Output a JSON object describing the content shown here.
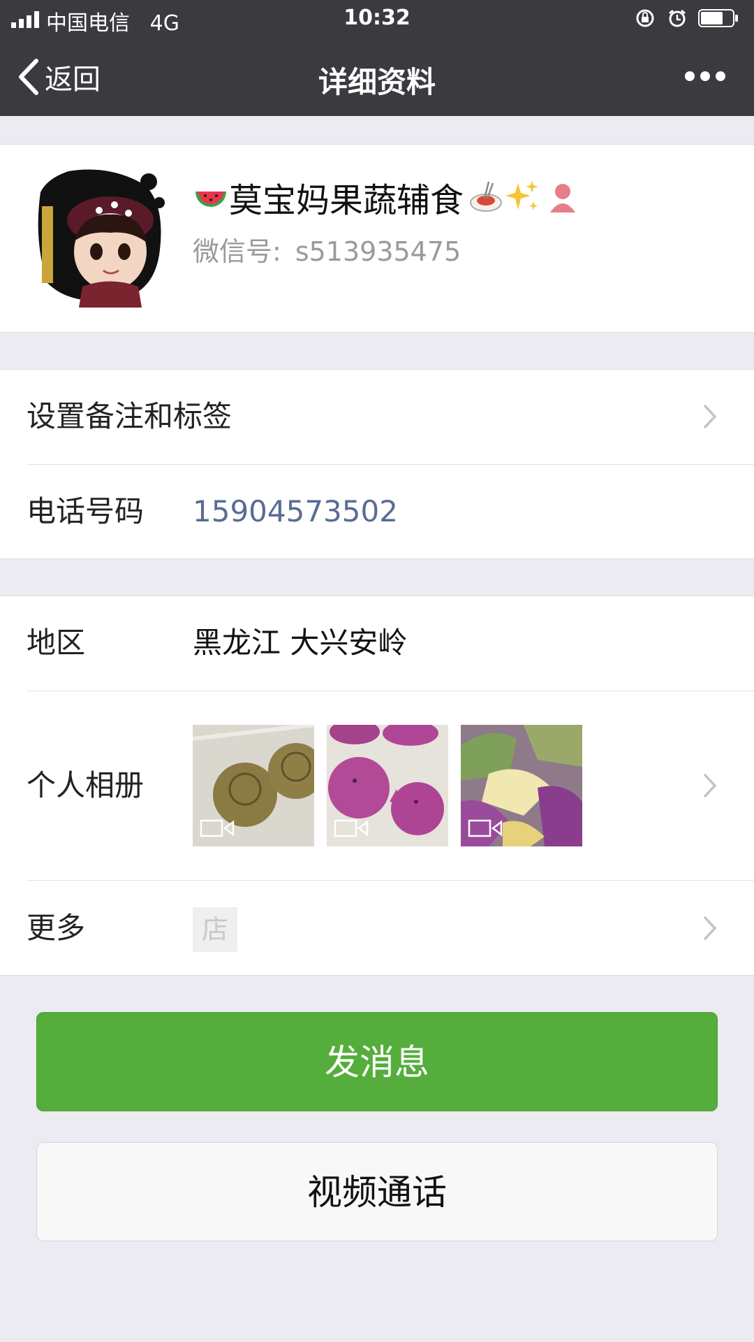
{
  "status_bar": {
    "carrier": "中国电信   4G",
    "time": "10:32",
    "battery_level": 0.7
  },
  "nav": {
    "back_label": "返回",
    "title": "详细资料",
    "more_icon": "more-dots-icon"
  },
  "profile": {
    "nickname": "莫宝妈果蔬辅食",
    "nickname_emojis": [
      "watermelon",
      "spaghetti",
      "sparkles",
      "person-silhouette"
    ],
    "wechat_id_label": "微信号:",
    "wechat_id": "s513935475"
  },
  "rows": {
    "remark": {
      "label": "设置备注和标签"
    },
    "phone": {
      "label": "电话号码",
      "value": "15904573502"
    },
    "region": {
      "label": "地区",
      "value": "黑龙江 大兴安岭"
    },
    "album": {
      "label": "个人相册"
    },
    "more": {
      "label": "更多",
      "shop_icon_text": "店"
    }
  },
  "buttons": {
    "send_message": "发消息",
    "video_call": "视频通话"
  },
  "colors": {
    "nav_bg": "#3a3a3f",
    "page_bg": "#ebebf1",
    "accent_green": "#55ad3b",
    "link_blue": "#586c94"
  }
}
